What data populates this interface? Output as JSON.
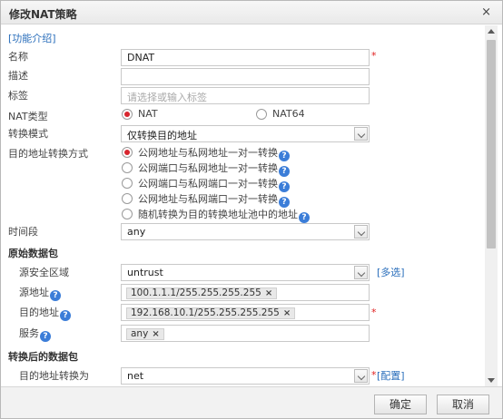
{
  "dialog": {
    "title": "修改NAT策略",
    "close": "×"
  },
  "help_link": "[功能介绍]",
  "form": {
    "name": {
      "label": "名称",
      "value": "DNAT",
      "req": "*"
    },
    "desc": {
      "label": "描述",
      "value": ""
    },
    "tag": {
      "label": "标签",
      "placeholder": "请选择或输入标签"
    },
    "nat_type": {
      "label": "NAT类型",
      "options": [
        "NAT",
        "NAT64"
      ],
      "selected": "NAT"
    },
    "mode": {
      "label": "转换模式",
      "value": "仅转换目的地址"
    },
    "dst_mode": {
      "label": "目的地址转换方式",
      "options": [
        "公网地址与私网地址一对一转换",
        "公网端口与私网地址一对一转换",
        "公网端口与私网端口一对一转换",
        "公网地址与私网端口一对一转换",
        "随机转换为目的转换地址池中的地址"
      ],
      "selected_index": 0
    },
    "time": {
      "label": "时间段",
      "value": "any"
    },
    "orig_section": "原始数据包",
    "src_zone": {
      "label": "源安全区域",
      "value": "untrust",
      "multi": "[多选]"
    },
    "src_addr": {
      "label": "源地址",
      "tag": "100.1.1.1/255.255.255.255"
    },
    "dst_addr": {
      "label": "目的地址",
      "tag": "192.168.10.1/255.255.255.255",
      "req": "*"
    },
    "service": {
      "label": "服务",
      "tag": "any"
    },
    "trans_section": "转换后的数据包",
    "dst_trans": {
      "label": "目的地址转换为",
      "value": "net",
      "req": "*",
      "config": "[配置]"
    }
  },
  "help_icon": "?",
  "tag_remove": "×",
  "buttons": {
    "ok": "确定",
    "cancel": "取消"
  },
  "colors": {
    "link": "#2a6ebb",
    "required": "#e02020",
    "radio_on": "#d8262f",
    "help": "#3b7dd8"
  }
}
